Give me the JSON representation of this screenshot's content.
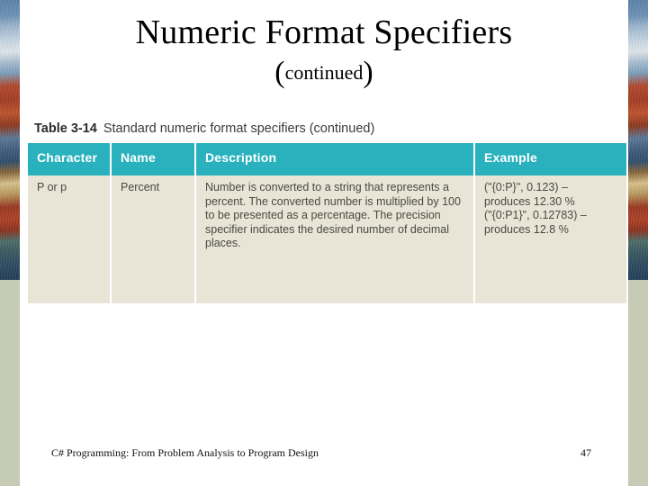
{
  "slide": {
    "title": "Numeric Format Specifiers",
    "subtitle_open_paren": "(",
    "subtitle_word": "continued",
    "subtitle_close_paren": ")",
    "background_color": "#ffffff"
  },
  "decoration": {
    "left_strip_name": "rooftops-photo-strip",
    "right_strip_name": "rooftops-photo-strip",
    "band_color": "#c5cbb4"
  },
  "table": {
    "caption_label": "Table 3-14",
    "caption_text": "Standard numeric format specifiers (continued)",
    "header_background": "#29b1bd",
    "header_text_color": "#ffffff",
    "body_background": "#e8e4d6",
    "columns": [
      "Character",
      "Name",
      "Description",
      "Example"
    ],
    "rows": [
      {
        "character": "P or p",
        "name": "Percent",
        "description": "Number is converted to a string that represents a percent. The converted number is multiplied by 100 to be presented as a percentage. The precision specifier indicates the desired number of decimal places.",
        "example_lines": [
          "(\"{0:P}\", 0.123) –",
          "produces 12.30 %",
          "(\"{0:P1}\", 0.12783) –",
          "produces 12.8 %"
        ]
      }
    ]
  },
  "footer": {
    "text": "C# Programming: From Problem Analysis to Program Design",
    "page_number": "47"
  }
}
